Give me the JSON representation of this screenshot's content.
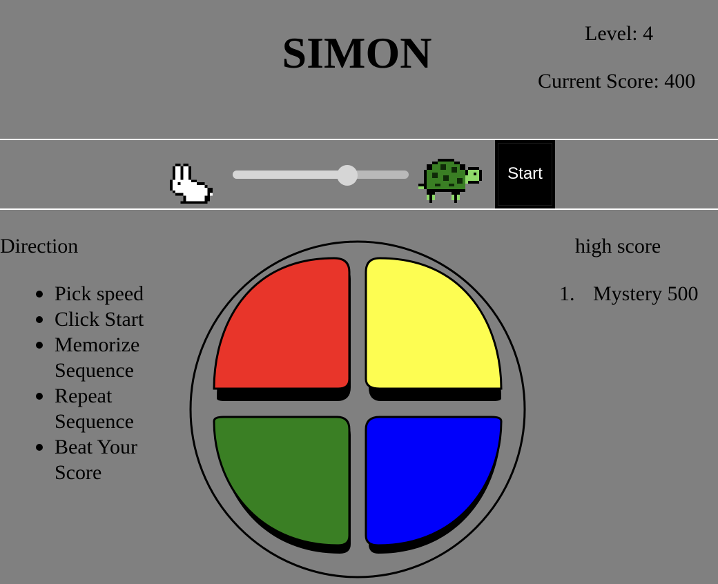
{
  "header": {
    "title": "SIMON",
    "level": "Level: 4",
    "score": "Current Score: 400"
  },
  "controls": {
    "fast_icon": "rabbit-icon",
    "slow_icon": "turtle-icon",
    "speed_level": 0.65,
    "start_label": "Start"
  },
  "directions": {
    "heading": "Direction",
    "items": [
      "Pick speed",
      "Click Start",
      "Memorize Sequence",
      "Repeat Sequence",
      "Beat Your Score"
    ]
  },
  "high_score": {
    "heading": "high score",
    "entries": [
      {
        "rank": "1.",
        "text": "Mystery 500"
      }
    ]
  },
  "colors": {
    "background": "#808080",
    "red": "#e8352a",
    "yellow": "#fdfd52",
    "green": "#3a7f24",
    "blue": "#0000fb",
    "start_button": "#000000"
  }
}
